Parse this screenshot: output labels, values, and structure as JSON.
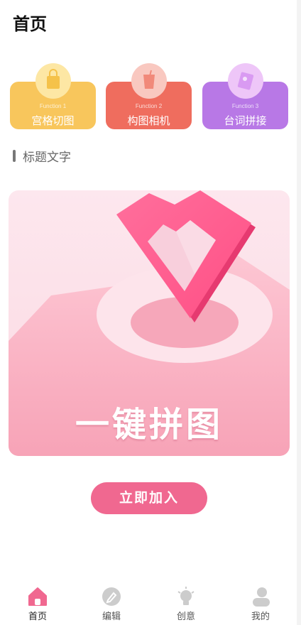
{
  "page": {
    "title": "首页"
  },
  "functions": [
    {
      "sub": "Function 1",
      "name": "宫格切图",
      "color": "#f8c65c"
    },
    {
      "sub": "Function 2",
      "name": "构图相机",
      "color": "#ef6d5e"
    },
    {
      "sub": "Function 3",
      "name": "台词拼接",
      "color": "#b878e6"
    }
  ],
  "section": {
    "title": "标题文字"
  },
  "banner": {
    "text": "一键拼图"
  },
  "cta": {
    "label": "立即加入"
  },
  "tabs": [
    {
      "label": "首页",
      "icon": "home-icon",
      "active": true
    },
    {
      "label": "编辑",
      "icon": "edit-icon",
      "active": false
    },
    {
      "label": "创意",
      "icon": "lightbulb-icon",
      "active": false
    },
    {
      "label": "我的",
      "icon": "user-icon",
      "active": false
    }
  ],
  "colors": {
    "accent": "#f06890",
    "tab_active": "#f06890",
    "tab_inactive": "#cccccc"
  }
}
